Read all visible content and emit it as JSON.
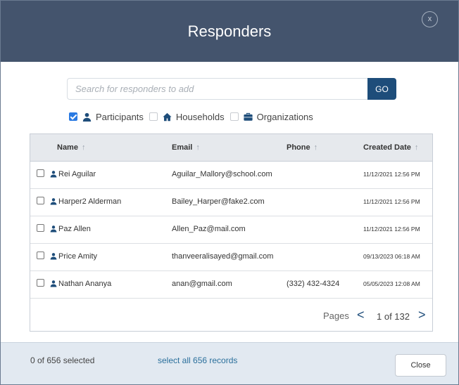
{
  "dialog": {
    "title": "Responders",
    "close_glyph": "x"
  },
  "search": {
    "placeholder": "Search for responders to add",
    "value": "",
    "go_label": "GO"
  },
  "filters": [
    {
      "label": "Participants",
      "checked": true,
      "icon": "user-icon"
    },
    {
      "label": "Households",
      "checked": false,
      "icon": "home-icon"
    },
    {
      "label": "Organizations",
      "checked": false,
      "icon": "briefcase-icon"
    }
  ],
  "table": {
    "columns": [
      "Name",
      "Email",
      "Phone",
      "Created Date"
    ],
    "sort_glyph": "↑",
    "rows": [
      {
        "name": "Rei Aguilar",
        "email": "Aguilar_Mallory@school.com",
        "phone": "",
        "created": "11/12/2021 12:56 PM"
      },
      {
        "name": "Harper2 Alderman",
        "email": "Bailey_Harper@fake2.com",
        "phone": "",
        "created": "11/12/2021 12:56 PM"
      },
      {
        "name": "Paz Allen",
        "email": "Allen_Paz@mail.com",
        "phone": "",
        "created": "11/12/2021 12:56 PM"
      },
      {
        "name": "Price Amity",
        "email": "thanveeralisayed@gmail.com",
        "phone": "",
        "created": "09/13/2023 06:18 AM"
      },
      {
        "name": "Nathan Ananya",
        "email": "anan@gmail.com",
        "phone": "(332) 432-4324",
        "created": "05/05/2023 12:08 AM"
      }
    ]
  },
  "pager": {
    "label": "Pages",
    "prev_glyph": "<",
    "info": "1 of 132",
    "next_glyph": ">"
  },
  "footer": {
    "selected_text": "0 of 656 selected",
    "select_all_text": "select all 656 records",
    "close_label": "Close"
  },
  "colors": {
    "header_bg": "#44546d",
    "accent": "#1e4d7a",
    "link": "#2a6f9b",
    "footer_bg": "#e2e9f1"
  }
}
